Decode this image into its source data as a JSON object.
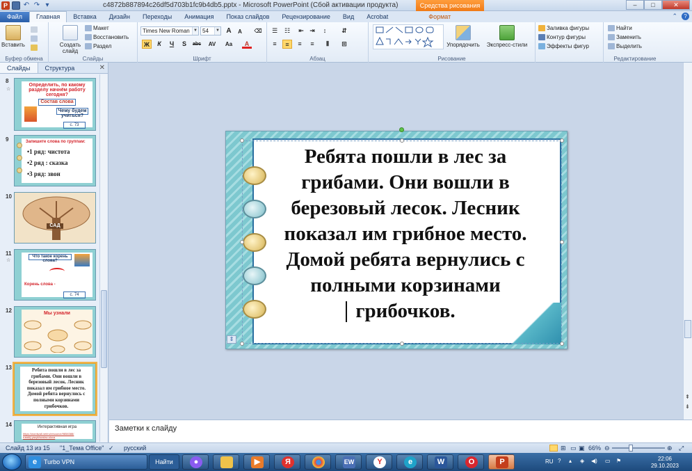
{
  "titlebar": {
    "doc_title": "c4872b887894c26df5d703b1fc9b4db5.pptx - Microsoft PowerPoint (Сбой активации продукта)",
    "context_tab": "Средства рисования",
    "minimize": "–",
    "maximize": "□",
    "close": "✕"
  },
  "tabs": {
    "file": "Файл",
    "items": [
      "Главная",
      "Вставка",
      "Дизайн",
      "Переходы",
      "Анимация",
      "Показ слайдов",
      "Рецензирование",
      "Вид",
      "Acrobat"
    ],
    "context": "Формат"
  },
  "ribbon": {
    "clipboard": {
      "paste": "Вставить",
      "label": "Буфер обмена"
    },
    "slides": {
      "new_slide_1": "Создать",
      "new_slide_2": "слайд",
      "layout": "Макет",
      "reset": "Восстановить",
      "section": "Раздел",
      "label": "Слайды"
    },
    "font": {
      "name": "Times New Roman",
      "size": "54",
      "grow": "A",
      "shrink": "A",
      "bold": "Ж",
      "italic": "К",
      "underline": "Ч",
      "shadow": "S",
      "strike": "abc",
      "spacing": "AV",
      "case": "Aa",
      "color": "A",
      "label": "Шрифт"
    },
    "paragraph": {
      "label": "Абзац"
    },
    "drawing": {
      "arrange": "Упорядочить",
      "quick_styles": "Экспресс-стили",
      "fill": "Заливка фигуры",
      "outline": "Контур фигуры",
      "effects": "Эффекты фигур",
      "label": "Рисование"
    },
    "editing": {
      "find": "Найти",
      "replace": "Заменить",
      "select": "Выделить",
      "label": "Редактирование"
    }
  },
  "pane": {
    "tab_slides": "Слайды",
    "tab_outline": "Структура",
    "close": "✕",
    "thumbs": [
      {
        "num": "8",
        "lines": [
          "Определить, по какому",
          "разделу начнём работу",
          "сегодня?",
          "Состав слова",
          "Чему будем",
          "учиться?",
          "с. 73"
        ]
      },
      {
        "num": "9",
        "lines": [
          "Запишите слова по группам:",
          "•1 ряд: чистота",
          "•2 ряд : сказка",
          "•3 ряд: звон"
        ]
      },
      {
        "num": "10",
        "lines": [
          "САД"
        ]
      },
      {
        "num": "11",
        "lines": [
          "Что такое корень",
          "слова?",
          "Корень слова -",
          "с. 74"
        ]
      },
      {
        "num": "12",
        "lines": [
          "Мы узнали"
        ]
      },
      {
        "num": "13",
        "lines": [
          "Ребята пошли в лес за",
          "грибами. Они вошли в",
          "березовый лесок. Лесник",
          "показал им грибное место.",
          "Домой ребята вернулись с",
          "полными корзинами",
          "грибочков."
        ]
      },
      {
        "num": "14",
        "lines": [
          "Интерактивная игра",
          "https://wordwall.net/ru/resource/9858388/",
          "russkij-yazyk/sostav-slova"
        ]
      }
    ]
  },
  "slide": {
    "lines": [
      "Ребята пошли в лес за",
      "грибами. Они вошли в",
      "березовый лесок. Лесник",
      "показал им грибное место.",
      "Домой ребята вернулись с",
      "полными корзинами",
      "грибочков."
    ]
  },
  "notes": {
    "placeholder": "Заметки к слайду"
  },
  "status": {
    "slide_count": "Слайд 13 из 15",
    "theme": "\"1_Тема Office\"",
    "language": "русский",
    "zoom": "66%",
    "zoom_percent": 66
  },
  "taskbar": {
    "turbo_vpn": "Turbo VPN",
    "search": "Найти",
    "lang": "RU",
    "time": "22:06",
    "date": "29.10.2023"
  },
  "colors": {
    "ribbon_bg": "#e2ebf6",
    "slide_teal": "#7dc8cf",
    "card_border": "#2a6fa0",
    "context_orange": "#f07a16",
    "selected_thumb": "#f3b34a"
  }
}
